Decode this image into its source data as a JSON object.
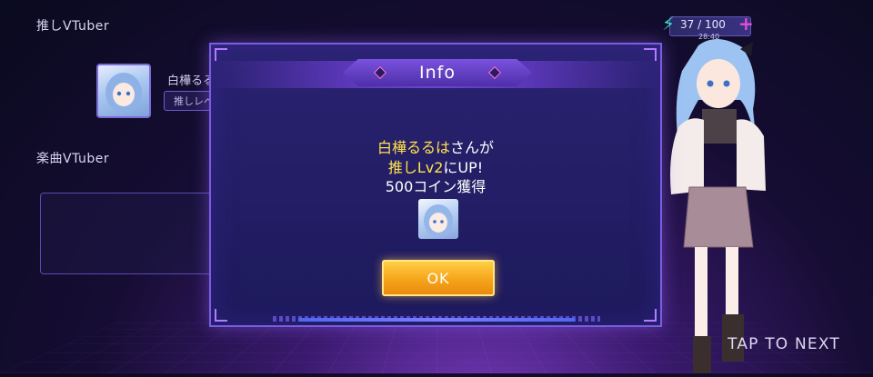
{
  "background": {
    "section_favorite_label": "推しVTuber",
    "favorite_name": "白樺るる",
    "favorite_level_chip": "推しレベ",
    "section_music_label": "楽曲VTuber"
  },
  "stamina": {
    "value": "37 / 100",
    "timer": "28:40",
    "bolt_icon": "lightning-bolt-icon",
    "plus_icon": "plus-icon"
  },
  "dialog": {
    "title": "Info",
    "message": {
      "name": "白樺るるは",
      "after_name": "さんが",
      "level": "推しLv2",
      "after_level": "にUP!",
      "reward": "500コイン獲得"
    },
    "ok_label": "OK"
  },
  "tap_to_next": "TAP TO NEXT",
  "colors": {
    "accent_purple": "#7a5de0",
    "highlight_yellow": "#ffe34a",
    "button_orange": "#f6a41a",
    "stamina_teal": "#3be0c8",
    "stamina_plus": "#e14fd6"
  }
}
